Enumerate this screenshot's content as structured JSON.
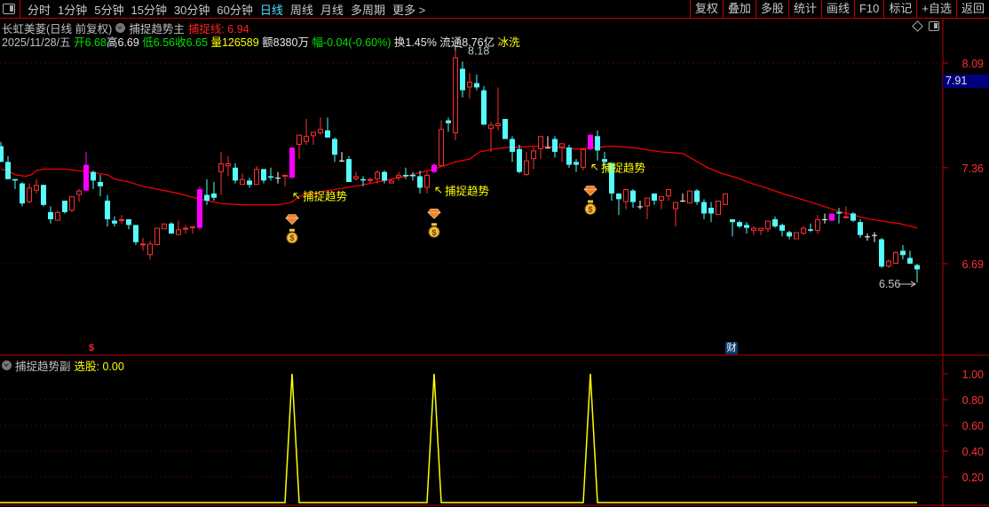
{
  "toolbar": {
    "tabs": [
      "分时",
      "1分钟",
      "5分钟",
      "15分钟",
      "30分钟",
      "60分钟",
      "日线",
      "周线",
      "月线",
      "多周期",
      "更多 >"
    ],
    "active_tab": "日线",
    "buttons": [
      "复权",
      "叠加",
      "多股",
      "统计",
      "画线",
      "F10",
      "标记",
      "+自选",
      "返回"
    ]
  },
  "header": {
    "stock": "长虹美菱(日线 前复权)",
    "indicator": "捕捉趋势主",
    "line_label": "捕捉线: 6.94"
  },
  "quote": {
    "date": "2025/11/28/五",
    "open": "开6.68",
    "high": "高6.69",
    "low": "低6.56",
    "close": "收6.65",
    "volume": "量126589",
    "amount": "额8380万",
    "change": "幅-0.04(-0.60%)",
    "turnover": "换1.45%",
    "float": "流通8.76亿",
    "sector": "冰洗"
  },
  "price_axis": {
    "ticks": [
      "8.09",
      "7.36",
      "6.69"
    ],
    "current": "7.91"
  },
  "annotations": {
    "high": "8.18",
    "low": "6.56",
    "signal_text": "捕捉趋势",
    "dollar_marker": "$",
    "finance_marker": "财"
  },
  "sub_panel": {
    "indicator": "捕捉趋势副",
    "value_label": "选股: 0.00",
    "ticks": [
      "1.00",
      "0.80",
      "0.60",
      "0.40",
      "0.20"
    ]
  },
  "colors": {
    "up": "#ff3030",
    "down": "#54fcfc",
    "highlight": "#ff00ff",
    "doji": "#ffffff",
    "ma": "#ff0000",
    "signal": "#ffff00",
    "grid": "#8b0000"
  },
  "icons": {
    "signal_top": "diamond-gem-icon",
    "signal_bottom": "money-bag-icon"
  },
  "chart_data": {
    "type": "candlestick",
    "ylim": [
      6.56,
      8.18
    ],
    "price_ticks": [
      8.09,
      7.36,
      6.69
    ],
    "ohlc": [
      [
        7.51,
        7.54,
        7.4,
        7.4
      ],
      [
        7.4,
        7.44,
        7.28,
        7.28
      ],
      [
        7.28,
        7.28,
        7.21,
        7.27
      ],
      [
        7.25,
        7.26,
        7.09,
        7.11
      ],
      [
        7.12,
        7.25,
        7.11,
        7.22
      ],
      [
        7.2,
        7.28,
        7.18,
        7.24
      ],
      [
        7.24,
        7.24,
        7.09,
        7.1
      ],
      [
        7.05,
        7.09,
        6.97,
        7.0
      ],
      [
        6.99,
        7.06,
        6.99,
        7.05
      ],
      [
        7.13,
        7.13,
        7.04,
        7.05
      ],
      [
        7.06,
        7.16,
        7.05,
        7.16
      ],
      [
        7.17,
        7.21,
        7.12,
        7.2
      ],
      [
        7.2,
        7.47,
        7.2,
        7.38
      ],
      [
        7.33,
        7.34,
        7.21,
        7.27
      ],
      [
        7.26,
        7.31,
        7.16,
        7.23
      ],
      [
        7.13,
        7.17,
        6.95,
        7.0
      ],
      [
        6.99,
        7.02,
        6.95,
        6.97
      ],
      [
        6.99,
        7.03,
        6.97,
        7.0
      ],
      [
        7.0,
        7.0,
        6.93,
        6.96
      ],
      [
        6.96,
        6.96,
        6.82,
        6.84
      ],
      [
        6.82,
        6.87,
        6.78,
        6.83
      ],
      [
        6.75,
        6.85,
        6.72,
        6.83
      ],
      [
        6.82,
        6.94,
        6.82,
        6.94
      ],
      [
        6.93,
        6.97,
        6.93,
        6.97
      ],
      [
        6.97,
        6.98,
        6.9,
        6.9
      ],
      [
        6.89,
        6.99,
        6.89,
        6.93
      ],
      [
        6.93,
        6.96,
        6.9,
        6.94
      ],
      [
        6.94,
        6.95,
        6.9,
        6.95
      ],
      [
        6.94,
        7.23,
        6.93,
        7.21
      ],
      [
        7.17,
        7.28,
        7.1,
        7.13
      ],
      [
        7.18,
        7.26,
        7.13,
        7.15
      ],
      [
        7.33,
        7.47,
        7.17,
        7.39
      ],
      [
        7.37,
        7.44,
        7.3,
        7.39
      ],
      [
        7.36,
        7.39,
        7.25,
        7.27
      ],
      [
        7.24,
        7.32,
        7.24,
        7.28
      ],
      [
        7.27,
        7.29,
        7.22,
        7.24
      ],
      [
        7.24,
        7.37,
        7.24,
        7.35
      ],
      [
        7.35,
        7.35,
        7.25,
        7.27
      ],
      [
        7.3,
        7.36,
        7.27,
        7.29
      ],
      [
        7.29,
        7.33,
        7.25,
        7.29
      ],
      [
        7.3,
        7.31,
        7.23,
        7.31
      ],
      [
        7.29,
        7.5,
        7.28,
        7.5
      ],
      [
        7.52,
        7.59,
        7.42,
        7.59
      ],
      [
        7.54,
        7.7,
        7.52,
        7.58
      ],
      [
        7.58,
        7.61,
        7.52,
        7.61
      ],
      [
        7.6,
        7.71,
        7.59,
        7.63
      ],
      [
        7.62,
        7.71,
        7.57,
        7.57
      ],
      [
        7.56,
        7.57,
        7.4,
        7.45
      ],
      [
        7.41,
        7.47,
        7.4,
        7.41
      ],
      [
        7.42,
        7.44,
        7.26,
        7.26
      ],
      [
        7.28,
        7.33,
        7.27,
        7.3
      ],
      [
        7.28,
        7.3,
        7.23,
        7.27
      ],
      [
        7.27,
        7.29,
        7.25,
        7.28
      ],
      [
        7.28,
        7.34,
        7.25,
        7.33
      ],
      [
        7.33,
        7.34,
        7.25,
        7.27
      ],
      [
        7.25,
        7.28,
        7.25,
        7.27
      ],
      [
        7.29,
        7.33,
        7.27,
        7.31
      ],
      [
        7.31,
        7.36,
        7.28,
        7.3
      ],
      [
        7.31,
        7.33,
        7.27,
        7.3
      ],
      [
        7.3,
        7.34,
        7.18,
        7.22
      ],
      [
        7.22,
        7.33,
        7.18,
        7.31
      ],
      [
        7.33,
        7.39,
        7.32,
        7.38
      ],
      [
        7.37,
        7.69,
        7.37,
        7.63
      ],
      [
        7.69,
        7.71,
        7.61,
        7.67
      ],
      [
        7.6,
        8.18,
        7.55,
        8.13
      ],
      [
        8.05,
        8.1,
        7.85,
        7.9
      ],
      [
        7.92,
        8.02,
        7.84,
        7.96
      ],
      [
        7.95,
        8.01,
        7.9,
        7.92
      ],
      [
        7.9,
        7.93,
        7.66,
        7.66
      ],
      [
        7.63,
        7.68,
        7.47,
        7.66
      ],
      [
        7.65,
        7.92,
        7.62,
        7.67
      ],
      [
        7.7,
        7.7,
        7.56,
        7.56
      ],
      [
        7.56,
        7.58,
        7.4,
        7.47
      ],
      [
        7.49,
        7.52,
        7.32,
        7.33
      ],
      [
        7.31,
        7.47,
        7.3,
        7.41
      ],
      [
        7.42,
        7.5,
        7.35,
        7.48
      ],
      [
        7.49,
        7.58,
        7.42,
        7.58
      ],
      [
        7.5,
        7.58,
        7.5,
        7.5
      ],
      [
        7.56,
        7.58,
        7.43,
        7.47
      ],
      [
        7.5,
        7.53,
        7.4,
        7.53
      ],
      [
        7.5,
        7.52,
        7.36,
        7.38
      ],
      [
        7.4,
        7.42,
        7.33,
        7.38
      ],
      [
        7.36,
        7.49,
        7.34,
        7.49
      ],
      [
        7.49,
        7.59,
        7.48,
        7.59
      ],
      [
        7.58,
        7.62,
        7.41,
        7.48
      ],
      [
        7.42,
        7.47,
        7.36,
        7.4
      ],
      [
        7.39,
        7.4,
        7.13,
        7.18
      ],
      [
        7.18,
        7.18,
        7.03,
        7.14
      ],
      [
        7.12,
        7.21,
        7.07,
        7.21
      ],
      [
        7.2,
        7.21,
        7.08,
        7.12
      ],
      [
        7.09,
        7.13,
        7.07,
        7.09
      ],
      [
        7.09,
        7.15,
        7.0,
        7.15
      ],
      [
        7.18,
        7.18,
        7.1,
        7.13
      ],
      [
        7.13,
        7.16,
        7.07,
        7.16
      ],
      [
        7.16,
        7.21,
        7.13,
        7.21
      ],
      [
        7.07,
        7.12,
        6.95,
        7.12
      ],
      [
        7.13,
        7.18,
        7.12,
        7.13
      ],
      [
        7.11,
        7.2,
        7.11,
        7.2
      ],
      [
        7.2,
        7.21,
        7.1,
        7.12
      ],
      [
        7.12,
        7.14,
        7.0,
        7.04
      ],
      [
        7.08,
        7.12,
        6.98,
        7.04
      ],
      [
        7.03,
        7.13,
        7.03,
        7.13
      ],
      [
        7.1,
        7.18,
        7.1,
        7.18
      ],
      [
        7.0,
        7.0,
        6.88,
        6.98
      ],
      [
        6.98,
        6.99,
        6.94,
        6.95
      ],
      [
        6.96,
        6.98,
        6.9,
        6.94
      ],
      [
        6.92,
        6.95,
        6.89,
        6.94
      ],
      [
        6.92,
        6.94,
        6.89,
        6.94
      ],
      [
        6.93,
        6.99,
        6.91,
        6.99
      ],
      [
        7.0,
        7.02,
        6.94,
        6.95
      ],
      [
        6.96,
        6.97,
        6.88,
        6.92
      ],
      [
        6.91,
        6.92,
        6.86,
        6.88
      ],
      [
        6.86,
        6.91,
        6.86,
        6.91
      ],
      [
        6.9,
        6.95,
        6.89,
        6.94
      ],
      [
        6.93,
        6.97,
        6.91,
        6.92
      ],
      [
        6.92,
        7.03,
        6.9,
        7.0
      ],
      [
        7.0,
        7.04,
        6.97,
        7.0
      ],
      [
        6.99,
        7.04,
        6.99,
        7.04
      ],
      [
        7.05,
        7.08,
        6.97,
        7.04
      ],
      [
        7.01,
        7.09,
        7.01,
        7.02
      ],
      [
        7.04,
        7.05,
        6.98,
        6.99
      ],
      [
        6.98,
        7.0,
        6.87,
        6.89
      ],
      [
        6.88,
        6.9,
        6.85,
        6.88
      ],
      [
        6.89,
        6.91,
        6.84,
        6.89
      ],
      [
        6.86,
        6.87,
        6.66,
        6.67
      ],
      [
        6.67,
        6.72,
        6.66,
        6.71
      ],
      [
        6.69,
        6.78,
        6.69,
        6.77
      ],
      [
        6.78,
        6.82,
        6.72,
        6.75
      ],
      [
        6.73,
        6.78,
        6.69,
        6.69
      ],
      [
        6.68,
        6.69,
        6.56,
        6.65
      ]
    ],
    "highlight_bars": [
      12,
      28,
      41,
      61,
      83,
      117
    ],
    "ma_line": [
      [
        0,
        7.35
      ],
      [
        1,
        7.34
      ],
      [
        2,
        7.31
      ],
      [
        3.5,
        7.3
      ],
      [
        4.3,
        7.31
      ],
      [
        5,
        7.34
      ],
      [
        6,
        7.35
      ],
      [
        9,
        7.35
      ],
      [
        12.4,
        7.33
      ],
      [
        15,
        7.31
      ],
      [
        16,
        7.28
      ],
      [
        18,
        7.26
      ],
      [
        20,
        7.23
      ],
      [
        23,
        7.2
      ],
      [
        25,
        7.18
      ],
      [
        28,
        7.14
      ],
      [
        31,
        7.11
      ],
      [
        34,
        7.1
      ],
      [
        39,
        7.1
      ],
      [
        41,
        7.12
      ],
      [
        42,
        7.16
      ],
      [
        46,
        7.2
      ],
      [
        51,
        7.24
      ],
      [
        55,
        7.28
      ],
      [
        57,
        7.3
      ],
      [
        61,
        7.35
      ],
      [
        64,
        7.4
      ],
      [
        66,
        7.42
      ],
      [
        67.4,
        7.47
      ],
      [
        69.5,
        7.49
      ],
      [
        71,
        7.5
      ],
      [
        76,
        7.51
      ],
      [
        81,
        7.49
      ],
      [
        86,
        7.51
      ],
      [
        89,
        7.5
      ],
      [
        93,
        7.47
      ],
      [
        96,
        7.46
      ],
      [
        97.4,
        7.42
      ],
      [
        99.5,
        7.36
      ],
      [
        101.5,
        7.32
      ],
      [
        103.6,
        7.29
      ],
      [
        105.7,
        7.25
      ],
      [
        107.7,
        7.22
      ],
      [
        110,
        7.18
      ],
      [
        114,
        7.12
      ],
      [
        118.3,
        7.05
      ],
      [
        122.4,
        7.0
      ],
      [
        126.5,
        6.97
      ],
      [
        129,
        6.94
      ]
    ],
    "signal_bars": [
      41,
      61,
      83
    ],
    "sub_series": {
      "ylim": [
        0,
        1.05
      ],
      "spikes_at": [
        41,
        61,
        83
      ],
      "spike_value": 1.0,
      "base_value": 0
    }
  }
}
